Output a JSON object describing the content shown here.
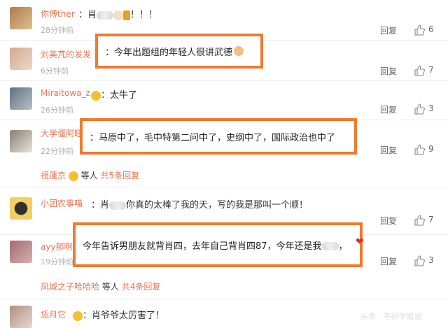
{
  "comments": [
    {
      "name": "你傅ther",
      "text": "肖",
      "text_tail": "！！！",
      "time": "28分钟前",
      "reply": "回复",
      "likes": "6"
    },
    {
      "name": "刘美芃的发发",
      "text": "今年出题组的年轻人很讲武德",
      "time": "6分钟前",
      "reply": "回复",
      "likes": "7"
    },
    {
      "name": "Miraitowa_z",
      "text": "太牛了",
      "time": "26分钟前",
      "reply": "回复",
      "likes": "3"
    },
    {
      "name": "大学僵阿旺",
      "text": "马原中了，毛中特第二问中了，史纲中了，国际政治也中了",
      "time": "22分钟前",
      "reply": "回复",
      "likes": "9",
      "sub": {
        "name": "視蓮京",
        "mid": "等人",
        "link": "共5条回复"
      }
    },
    {
      "name": "小团农事喵",
      "text_head": "肖",
      "text": "你真的太棒了我的天，写的我是那叫一个顺！",
      "time": "28分钟前",
      "reply": "回复",
      "likes": "7"
    },
    {
      "name": "ayy那啊啊",
      "text": "今年告诉男朋友就背肖四，去年自己背肖四87，今年还是我",
      "time": "19分钟前",
      "reply": "回复",
      "likes": "3",
      "sub": {
        "name": "凤城之子哈哈哈",
        "mid": "等人",
        "link": "共4条回复"
      }
    },
    {
      "name": "恁月它",
      "text": "肖爷爷太厉害了！"
    }
  ],
  "watermark": "头条 · 考研学姐说",
  "colors": {
    "username": "#eb7350",
    "highlight_border": "#f07a2e"
  }
}
